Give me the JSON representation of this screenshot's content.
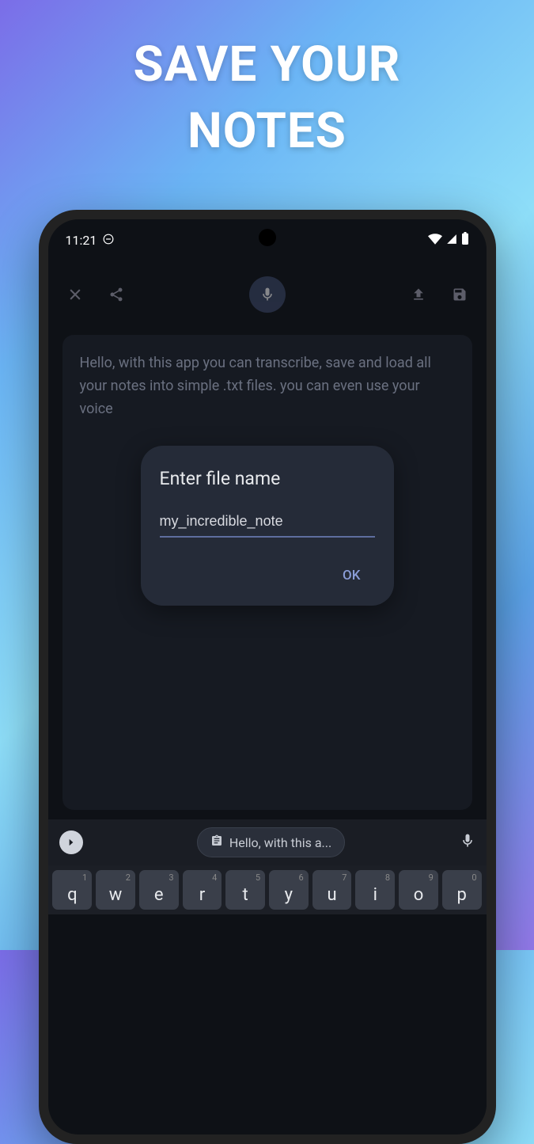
{
  "promo": {
    "title_line1": "SAVE YOUR",
    "title_line2": "NOTES"
  },
  "status": {
    "time": "11:21"
  },
  "note": {
    "text": "Hello, with this app you can transcribe, save and load all your notes into simple .txt files. you can even use your voice"
  },
  "dialog": {
    "title": "Enter file name",
    "input_value": "my_incredible_note",
    "ok_label": "OK"
  },
  "suggestion": {
    "chip_text": "Hello, with this a..."
  },
  "keyboard": {
    "row1": [
      {
        "char": "q",
        "num": "1"
      },
      {
        "char": "w",
        "num": "2"
      },
      {
        "char": "e",
        "num": "3"
      },
      {
        "char": "r",
        "num": "4"
      },
      {
        "char": "t",
        "num": "5"
      },
      {
        "char": "y",
        "num": "6"
      },
      {
        "char": "u",
        "num": "7"
      },
      {
        "char": "i",
        "num": "8"
      },
      {
        "char": "o",
        "num": "9"
      },
      {
        "char": "p",
        "num": "0"
      }
    ]
  }
}
